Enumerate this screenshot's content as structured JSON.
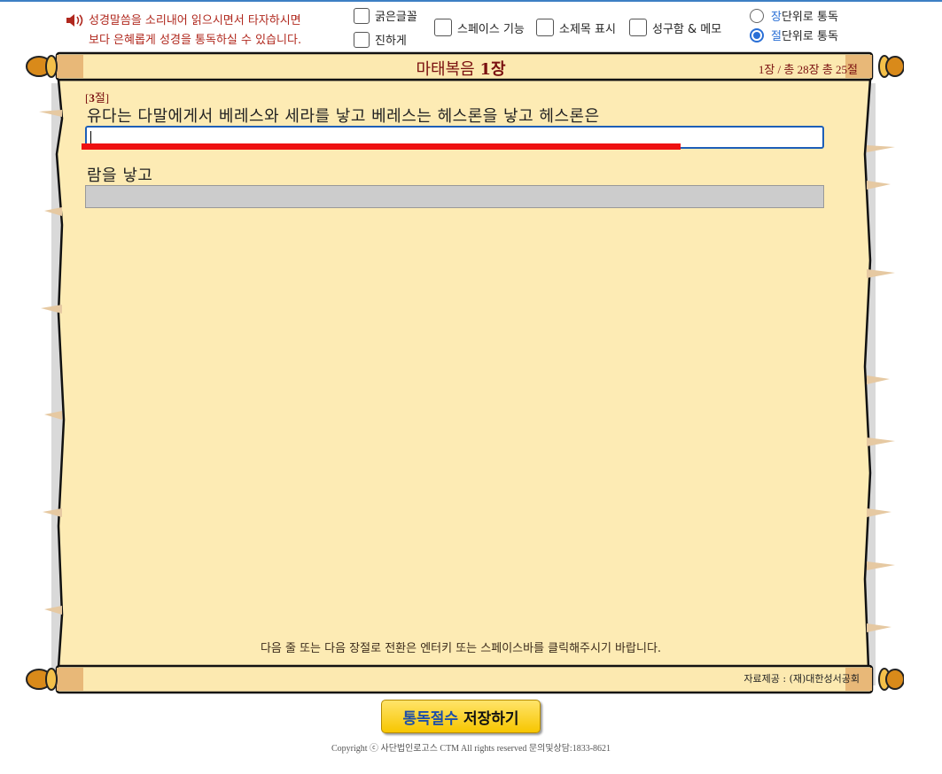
{
  "notice": {
    "line1": "성경말씀을 소리내어 읽으시면서 타자하시면",
    "line2": "보다 은혜롭게 성경을 통독하실 수 있습니다."
  },
  "options": {
    "bold_font": "굵은글꼴",
    "darker": "진하게",
    "space_feature": "스페이스 기능",
    "subtitle_display": "소제목 표시",
    "phrase_memo": "성구함 & 메모"
  },
  "reading_unit": {
    "chapter": {
      "prefix": "장",
      "suffix": " 단위로 통독",
      "selected": false
    },
    "verse": {
      "prefix": "절",
      "suffix": " 단위로 통독",
      "selected": true
    }
  },
  "scroll": {
    "title_book": "마태복음 ",
    "title_chapter": "1장",
    "count": "1장 / 총 28장   총 25절",
    "verse_label_num": "3",
    "verse_label_suffix": "절]",
    "verse_label_prefix": "[",
    "verse_line1": "유다는 다말에게서 베레스와 세라를 낳고 베레스는 헤스론을 낳고 헤스론은",
    "verse_line2": "람을 낳고",
    "typing_progress": 0.81,
    "hint": "다음 줄 또는 다음 장절로 전환은 엔터키 또는 스페이스바를 클릭해주시기 바랍니다.",
    "source": "자료제공 : (재)대한성서공회"
  },
  "save_button": {
    "part1": "통독절수",
    "part2": "저장하기"
  },
  "copyright": "Copyright ⓒ 사단법인로고스 CTM All rights reserved 문의및상담:1833-8621",
  "colors": {
    "accent": "#2a6fd6",
    "title": "#7a1010",
    "progress": "#ee1111",
    "parchment": "#fdebb4"
  }
}
